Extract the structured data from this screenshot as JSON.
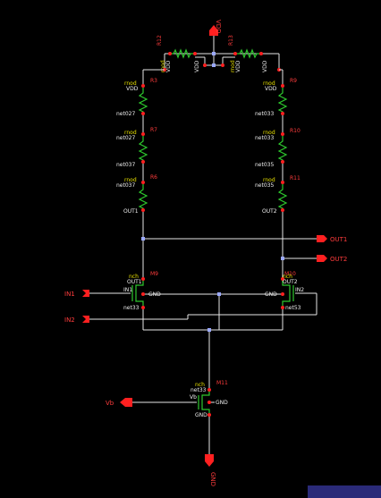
{
  "colors": {
    "wire": "#e6e6e6",
    "device": "#2ec82e",
    "pin": "#ff2020",
    "label": "#f0f0f0",
    "subtext": "#e8e000",
    "refdes": "#ff3c3c",
    "background": "#000000"
  },
  "pins": {
    "vdd": "VDD",
    "gnd": "GND",
    "out1": "OUT1",
    "out2": "OUT2",
    "in1": "IN1",
    "in2": "IN2",
    "vb": "Vb"
  },
  "resistors": {
    "r12": {
      "refdes": "R12",
      "nmod": "rnod",
      "net": "VDD",
      "net2": "VDD"
    },
    "r13": {
      "refdes": "R13",
      "nmod": "rnod",
      "net": "VDD",
      "net2": "VDD"
    },
    "r3": {
      "refdes": "R3",
      "nmod": "rnod",
      "net": "VDD"
    },
    "r7": {
      "refdes": "R7",
      "nmod": "rnod",
      "net": "net027"
    },
    "r6": {
      "refdes": "R6",
      "nmod": "rnod",
      "net": "net037"
    },
    "r9": {
      "refdes": "R9",
      "nmod": "rnod",
      "net": "VDD"
    },
    "r10": {
      "refdes": "R10",
      "nmod": "rnod",
      "net": "net033"
    },
    "r11": {
      "refdes": "R11",
      "nmod": "rnod",
      "net": "net035"
    }
  },
  "net_labels": {
    "left_027": "net027",
    "left_037": "net037",
    "left_out1": "OUT1",
    "right_033": "net033",
    "right_035": "net035",
    "right_out2": "OUT2"
  },
  "transistors": {
    "m9": {
      "refdes": "M9",
      "model": "nch",
      "drain": "OUT1",
      "gate": "IN1",
      "bulk": "GND",
      "source": "net33"
    },
    "m10": {
      "refdes": "M10",
      "model": "nch",
      "drain": "OUT2",
      "gate": "IN2",
      "bulk": "GND",
      "source": "net53"
    },
    "m11": {
      "refdes": "M11",
      "model": "nch",
      "drain": "net33",
      "gate": "Vb",
      "bulk": "GND",
      "source": "GND"
    }
  }
}
